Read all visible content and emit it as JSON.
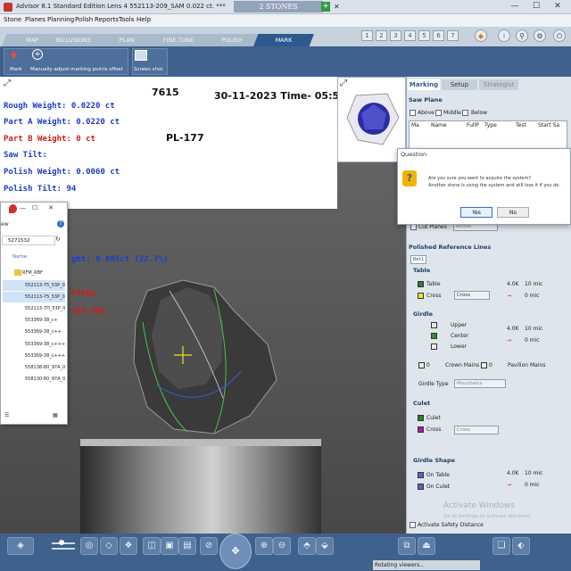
{
  "window": {
    "app_title": "Advisor 8.1 Standard Edition Lens 4   552113-209_SAM   0.022 ct. ***",
    "doc_tab_title": "2 STONES",
    "minimize": "—",
    "maximize": "☐",
    "close": "✕"
  },
  "menu": [
    "Stone",
    "Planes",
    "Planning",
    "Polish",
    "Reports",
    "Tools",
    "Help"
  ],
  "tabs": [
    "MAP",
    "INCLUSIONS",
    "PLAN",
    "FINE TUNE",
    "POLISH",
    "MARK"
  ],
  "active_tab": "MARK",
  "number_boxes": [
    "1",
    "2",
    "3",
    "4",
    "5",
    "6",
    "7"
  ],
  "toolbar": {
    "mark_label": "Mark",
    "manual_label": "Manually adjust marking points offset",
    "screenshot_label": "Screen shot"
  },
  "overlay": {
    "stone_id": "7615",
    "datetime": "30-11-2023 Time- 05:55",
    "rough_weight": "Rough Weight: 0.0220 ct",
    "part_a": "Part A Weight: 0.0220 ct",
    "part_b": "Part B Weight: 0 ct",
    "saw_tilt": "Saw Tilt:",
    "polish_weight": "Polish Weight: 0.0060 ct",
    "polish_tilt": "Polish Tilt: 94",
    "pl": "PL-177",
    "partial_weight": "ght: 0.005ct (22.7%)",
    "dim1": "#t60µ",
    "dim2": "1ē5.30µ"
  },
  "explorer": {
    "close": "✕",
    "maximize": "☐",
    "minimize": "—",
    "view": "ew",
    "path": "5271532",
    "header": "Name",
    "files": [
      "RFM_RBF",
      "552113-75_53P_00",
      "552113-75_53P_00",
      "552113-7Π_53P_00",
      "553369-38_c+",
      "553369-38_c++",
      "553369-38_c+++",
      "553369-38_c++++",
      "558138-80_97A_00",
      "558130-80_97A_00"
    ]
  },
  "dialog": {
    "title": "Question",
    "message_line1": "Are you sure you want to acquire the system?",
    "message_line2": "Another stone is using the system and will lose it if you do.",
    "yes": "Yes",
    "no": "No"
  },
  "panel": {
    "tabs": [
      "Marking",
      "Setup",
      "Strategist"
    ],
    "saw_plane": "Saw Plane",
    "saw_opts": [
      "Above",
      "Middle",
      "Below"
    ],
    "saw_cols": [
      "Ma",
      "Name",
      "FullP",
      "Type",
      "Test",
      "Start Sa"
    ],
    "cut_planes": "Cut Planes",
    "cut_planes_dd": "Active",
    "polished_ref": "Polished Reference Lines",
    "ret_tab": "Ret1",
    "table_hdr": "Table",
    "table_opt": "Table",
    "cross_opt": "Cross",
    "cross_dd": "Cross",
    "table_val1": "4.0K",
    "table_val2": "10 mic",
    "table_val3": "0 mic",
    "girdle_hdr": "Girdle",
    "upper": "Upper",
    "center": "Center",
    "lower": "Lower",
    "girdle_val1": "4.0K",
    "girdle_val2": "10 mic",
    "girdle_val3": "0 mic",
    "crown_mains": "Crown Mains",
    "pavilion_mains": "Pavilion Mains",
    "zero_a": "0",
    "zero_b": "0",
    "girdle_type": "Girdle Type",
    "girdle_type_dd": "Mountains",
    "culet_hdr": "Culet",
    "culet_opt": "Culet",
    "culet_cross": "Cross",
    "culet_cross_dd": "Cross",
    "girdle_shape": "Girdle Shape",
    "on_table": "On Table",
    "on_culet": "On Culet",
    "gs_val1": "4.0K",
    "gs_val2": "10 mic",
    "gs_val3": "0 mic",
    "activate_safety": "Activate Safety Distance",
    "watermark1": "Activate Windows",
    "watermark2": "Go to Settings to activate Windows."
  },
  "status": "Rotating viewers...",
  "colors": {
    "accent": "#2d5a8e",
    "toolbar": "#3e618d",
    "red_text": "#d01c1c",
    "blue_text": "#1c3cc8"
  }
}
